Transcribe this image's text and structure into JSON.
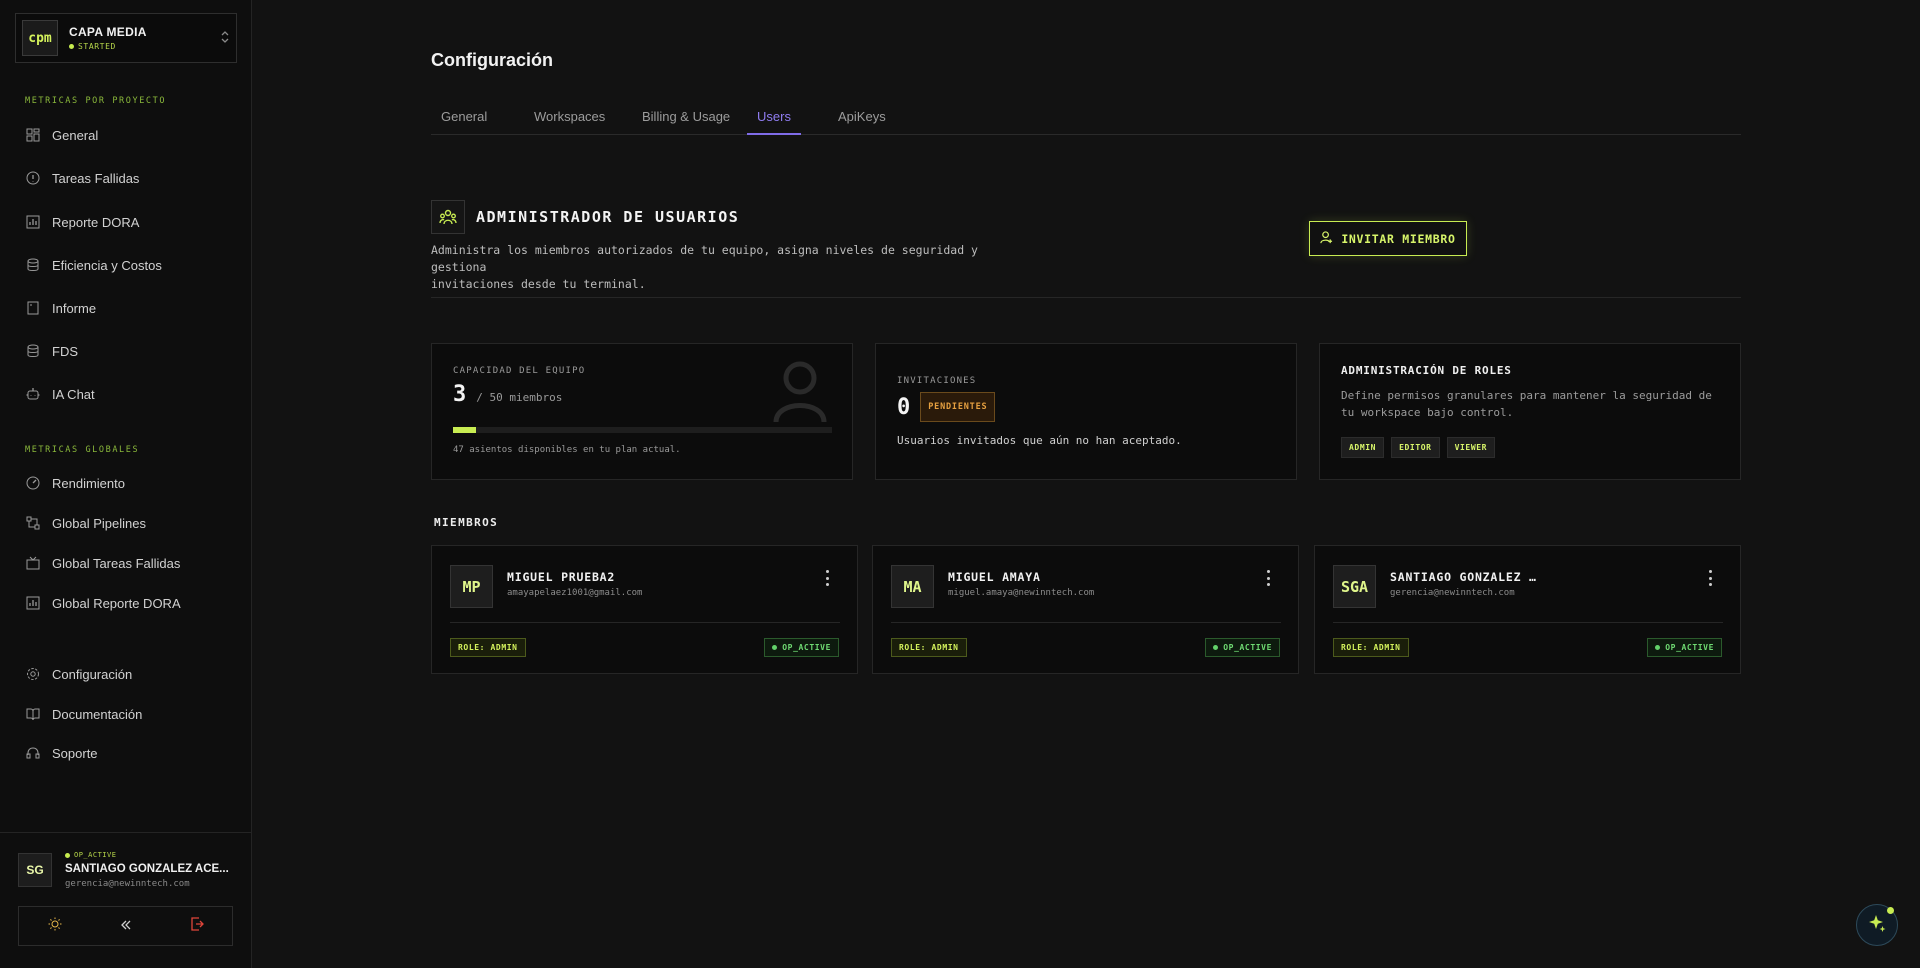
{
  "sidebar": {
    "logo": "cpm",
    "project_name": "CAPA MEDIA",
    "project_status": "STARTED",
    "section_project": "METRICAS POR PROYECTO",
    "section_global": "METRICAS GLOBALES",
    "project_items": [
      {
        "label": "General",
        "icon": "dashboard-icon"
      },
      {
        "label": "Tareas Fallidas",
        "icon": "alert-circle-icon"
      },
      {
        "label": "Reporte DORA",
        "icon": "bar-chart-icon"
      },
      {
        "label": "Eficiencia y Costos",
        "icon": "database-icon"
      },
      {
        "label": "Informe",
        "icon": "document-icon"
      },
      {
        "label": "FDS",
        "icon": "database-icon"
      },
      {
        "label": "IA Chat",
        "icon": "bot-icon"
      }
    ],
    "global_items": [
      {
        "label": "Rendimiento",
        "icon": "gauge-icon"
      },
      {
        "label": "Global Pipelines",
        "icon": "pipeline-icon"
      },
      {
        "label": "Global Tareas Fallidas",
        "icon": "tv-icon"
      },
      {
        "label": "Global Reporte DORA",
        "icon": "bar-chart-icon"
      }
    ],
    "bottom_items": [
      {
        "label": "Configuración",
        "icon": "gear-icon"
      },
      {
        "label": "Documentación",
        "icon": "book-icon"
      },
      {
        "label": "Soporte",
        "icon": "headset-icon"
      }
    ],
    "user": {
      "initials": "SG",
      "status": "OP_ACTIVE",
      "name": "SANTIAGO GONZALEZ ACE...",
      "email": "gerencia@newinntech.com"
    }
  },
  "main": {
    "title": "Configuración",
    "tabs": [
      {
        "label": "General",
        "active": false
      },
      {
        "label": "Workspaces",
        "active": false
      },
      {
        "label": "Billing & Usage",
        "active": false
      },
      {
        "label": "Users",
        "active": true
      },
      {
        "label": "ApiKeys",
        "active": false
      }
    ],
    "admin": {
      "title": "ADMINISTRADOR DE USUARIOS",
      "description_line1": "Administra los miembros autorizados de tu equipo, asigna niveles de seguridad y gestiona",
      "description_line2": "invitaciones desde tu terminal.",
      "invite_button": "INVITAR MIEMBRO"
    },
    "capacity": {
      "label": "CAPACIDAD DEL EQUIPO",
      "used": "3",
      "total_text": "/ 50 miembros",
      "fraction": 0.06,
      "available_text": "47 asientos disponibles en tu plan actual."
    },
    "invitations": {
      "label": "INVITACIONES",
      "count": "0",
      "badge": "PENDIENTES",
      "description": "Usuarios invitados que aún no han aceptado."
    },
    "roles": {
      "title": "ADMINISTRACIÓN DE ROLES",
      "description_line1": "Define permisos granulares para mantener la seguridad de",
      "description_line2": "tu workspace bajo control.",
      "chips": [
        "ADMIN",
        "EDITOR",
        "VIEWER"
      ]
    },
    "members_title": "MIEMBROS",
    "members": [
      {
        "initials": "MP",
        "name": "MIGUEL PRUEBA2",
        "email": "amayapelaez1001@gmail.com",
        "role": "ROLE: ADMIN",
        "status": "OP_ACTIVE"
      },
      {
        "initials": "MA",
        "name": "MIGUEL AMAYA",
        "email": "miguel.amaya@newinntech.com",
        "role": "ROLE: ADMIN",
        "status": "OP_ACTIVE"
      },
      {
        "initials": "SGA",
        "name": "SANTIAGO GONZALEZ …",
        "email": "gerencia@newinntech.com",
        "role": "ROLE: ADMIN",
        "status": "OP_ACTIVE"
      }
    ]
  },
  "colors": {
    "accent_lime": "#c8ec52",
    "tab_active": "#7f6ce8",
    "pending": "#e6a040",
    "active_green": "#62d36a",
    "logout_red": "#e0453a",
    "theme_icon": "#e8b84a"
  },
  "fab": {
    "icon": "sparkle-icon"
  }
}
